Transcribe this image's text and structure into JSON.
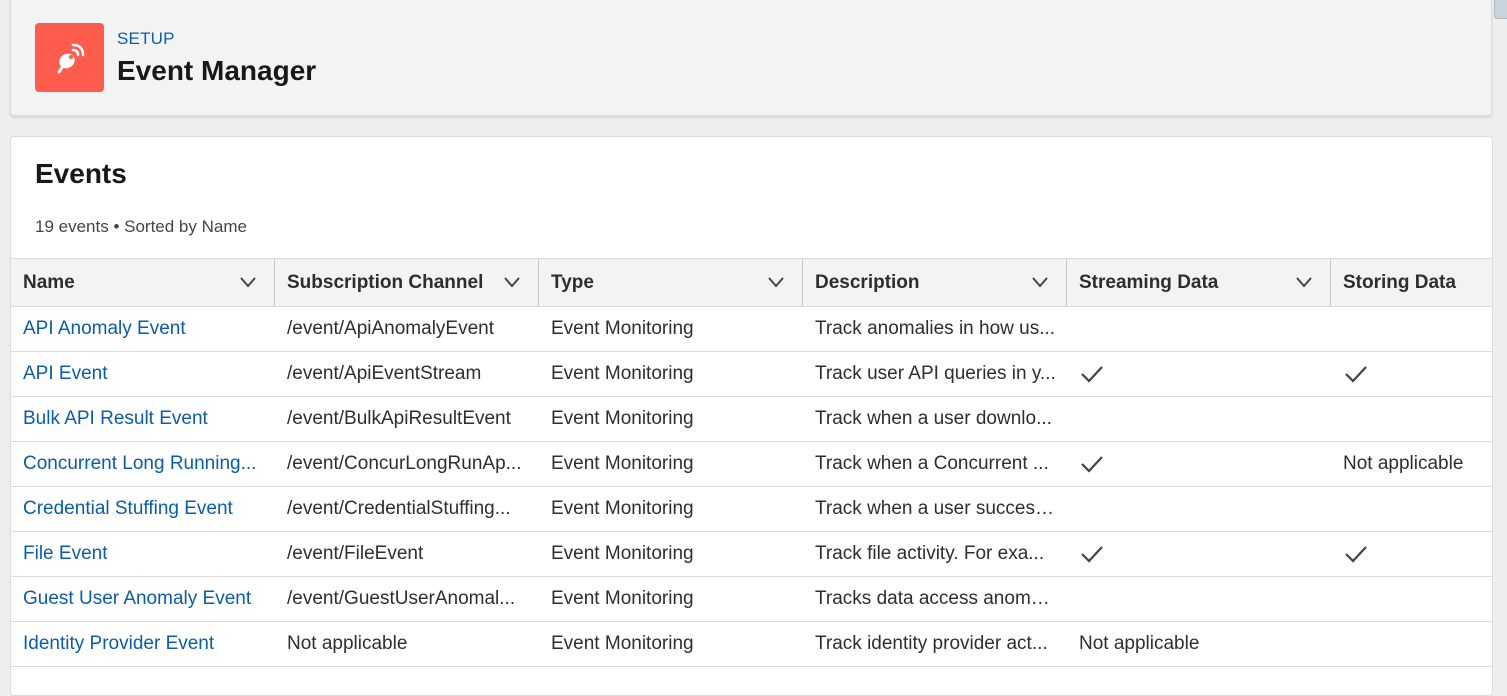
{
  "header": {
    "section": "SETUP",
    "title": "Event Manager",
    "icon": "satellite-dish-icon",
    "accent_color": "#fe5c4c"
  },
  "list": {
    "title": "Events",
    "meta": "19 events • Sorted by Name",
    "columns": [
      {
        "label": "Name",
        "sortable": true
      },
      {
        "label": "Subscription Channel",
        "sortable": true
      },
      {
        "label": "Type",
        "sortable": true
      },
      {
        "label": "Description",
        "sortable": true
      },
      {
        "label": "Streaming Data",
        "sortable": true
      },
      {
        "label": "Storing Data",
        "sortable": false
      }
    ],
    "rows": [
      {
        "name": "API Anomaly Event",
        "channel": "/event/ApiAnomalyEvent",
        "type": "Event Monitoring",
        "description": "Track anomalies in how us...",
        "streaming": "",
        "storing": ""
      },
      {
        "name": "API Event",
        "channel": "/event/ApiEventStream",
        "type": "Event Monitoring",
        "description": "Track user API queries in y...",
        "streaming": "check",
        "storing": "check"
      },
      {
        "name": "Bulk API Result Event",
        "channel": "/event/BulkApiResultEvent",
        "type": "Event Monitoring",
        "description": "Track when a user downlo...",
        "streaming": "",
        "storing": ""
      },
      {
        "name": "Concurrent Long Running...",
        "channel": "/event/ConcurLongRunAp...",
        "type": "Event Monitoring",
        "description": "Track when a Concurrent ...",
        "streaming": "check",
        "storing": "Not applicable"
      },
      {
        "name": "Credential Stuffing Event",
        "channel": "/event/CredentialStuffing...",
        "type": "Event Monitoring",
        "description": "Track when a user success...",
        "streaming": "",
        "storing": ""
      },
      {
        "name": "File Event",
        "channel": "/event/FileEvent",
        "type": "Event Monitoring",
        "description": "Track file activity. For exa...",
        "streaming": "check",
        "storing": "check"
      },
      {
        "name": "Guest User Anomaly Event",
        "channel": "/event/GuestUserAnomal...",
        "type": "Event Monitoring",
        "description": "Tracks data access anomal...",
        "streaming": "",
        "storing": ""
      },
      {
        "name": "Identity Provider Event",
        "channel": "Not applicable",
        "type": "Event Monitoring",
        "description": "Track identity provider act...",
        "streaming": "Not applicable",
        "storing": ""
      }
    ]
  },
  "colors": {
    "link": "#0b5cab",
    "header_bg": "#f3f3f3",
    "page_bg": "#eeeeee"
  }
}
